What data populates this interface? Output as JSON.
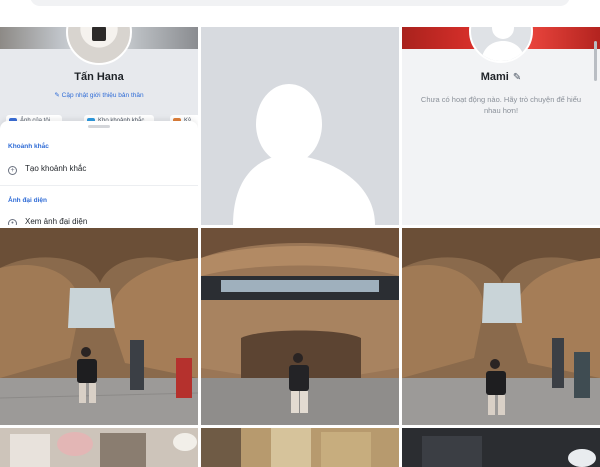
{
  "profile_one": {
    "name": "Tấn Hana",
    "update_intro": "Cập nhật giới thiệu bản thân",
    "chips": [
      "Ảnh của tôi",
      "Kho khoảnh khắc",
      "Kỷ"
    ]
  },
  "sheet": {
    "section_moments": "Khoảnh khắc",
    "create_moment": "Tạo khoảnh khắc",
    "section_avatar": "Ảnh đại diện",
    "view_avatar": "Xem ảnh đại diện"
  },
  "profile_two": {
    "name": "Mami",
    "empty_message": "Chưa có hoạt động nào. Hãy trò chuyện để hiểu nhau hơn!"
  },
  "icons": [
    "plus-circle-icon",
    "eye-icon",
    "edit-pencil-icon",
    "default-user-icon"
  ],
  "colors": {
    "accent_blue": "#2e6bd6",
    "cover_red": "#d62f2a",
    "placeholder_gray": "#d7dadf"
  }
}
